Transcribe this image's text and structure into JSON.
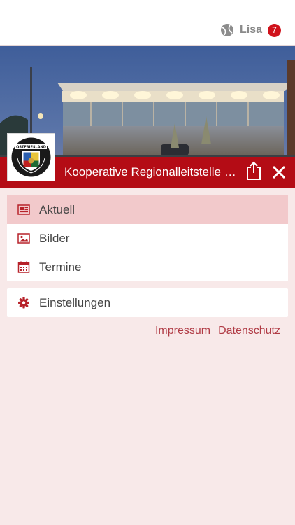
{
  "header": {
    "user_name": "Lisa",
    "notification_count": "7",
    "user_icon": "tennis-ball-icon"
  },
  "hero": {
    "title": "Kooperative Regionalleitstelle Ostfriesland",
    "logo_text": "OSTFRIESLAND",
    "logo_subtext": "REGIONALLEITSTELLE"
  },
  "menu": {
    "items": [
      {
        "label": "Aktuell",
        "icon": "newspaper-icon",
        "active": true
      },
      {
        "label": "Bilder",
        "icon": "image-icon",
        "active": false
      },
      {
        "label": "Termine",
        "icon": "calendar-icon",
        "active": false
      }
    ],
    "settings_label": "Einstellungen",
    "settings_icon": "gear-icon"
  },
  "footer": {
    "impressum": "Impressum",
    "datenschutz": "Datenschutz"
  },
  "colors": {
    "accent": "#b40c15",
    "active_bg": "#f2c9cb",
    "page_bg": "#f8e9e9",
    "badge": "#d0121b"
  }
}
